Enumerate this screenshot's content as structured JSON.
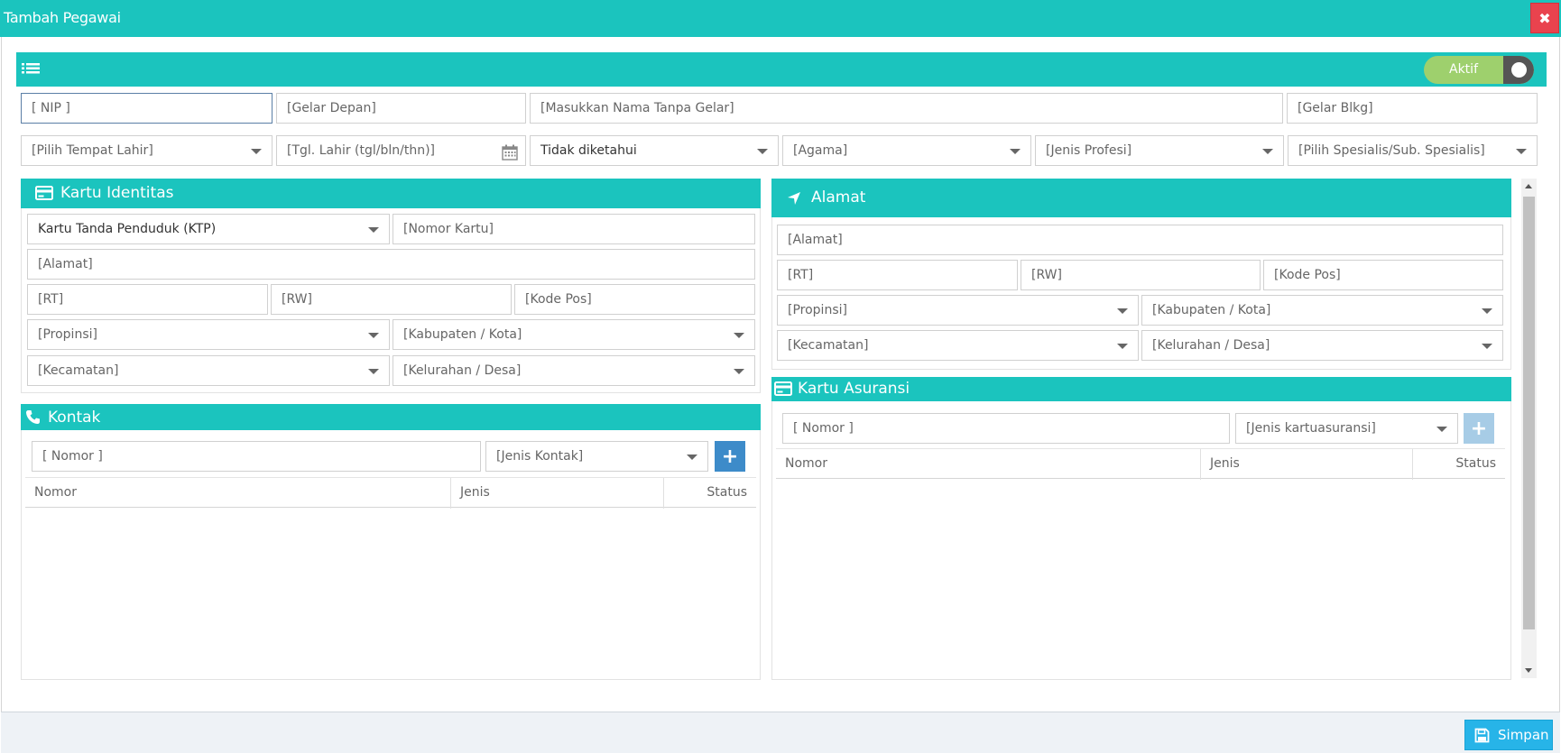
{
  "window": {
    "title": "Tambah Pegawai",
    "close": "✖"
  },
  "status_toggle": {
    "label": "Aktif",
    "on": true
  },
  "row1": {
    "nip": "[ NIP ]",
    "gelar_depan": "[Gelar Depan]",
    "nama": "[Masukkan Nama Tanpa Gelar]",
    "gelar_belakang": "[Gelar Blkg]"
  },
  "row2": {
    "tempat_lahir": "[Pilih Tempat Lahir]",
    "tgl_lahir": "[Tgl. Lahir (tgl/bln/thn)]",
    "jenis_kelamin": "Tidak diketahui",
    "agama": "[Agama]",
    "jenis_profesi": "[Jenis Profesi]",
    "spesialis": "[Pilih Spesialis/Sub. Spesialis]"
  },
  "kartu_identitas": {
    "title": "Kartu Identitas",
    "jenis_kartu": "Kartu Tanda Penduduk (KTP)",
    "nomor_kartu": "[Nomor Kartu]",
    "alamat": "[Alamat]",
    "rt": "[RT]",
    "rw": "[RW]",
    "kode_pos": "[Kode Pos]",
    "propinsi": "[Propinsi]",
    "kabupaten": "[Kabupaten / Kota]",
    "kecamatan": "[Kecamatan]",
    "kelurahan": "[Kelurahan / Desa]"
  },
  "alamat": {
    "title": "Alamat",
    "alamat": "[Alamat]",
    "rt": "[RT]",
    "rw": "[RW]",
    "kode_pos": "[Kode Pos]",
    "propinsi": "[Propinsi]",
    "kabupaten": "[Kabupaten / Kota]",
    "kecamatan": "[Kecamatan]",
    "kelurahan": "[Kelurahan / Desa]"
  },
  "kontak": {
    "title": "Kontak",
    "nomor": "[ Nomor ]",
    "jenis": "[Jenis Kontak]",
    "add": "+",
    "columns": [
      "Nomor",
      "Jenis",
      "Status"
    ]
  },
  "kartu_asuransi": {
    "title": "Kartu Asuransi",
    "nomor": "[ Nomor ]",
    "jenis": "[Jenis kartuasuransi]",
    "add": "+",
    "columns": [
      "Nomor",
      "Jenis",
      "Status"
    ]
  },
  "footer": {
    "save_label": "Simpan"
  },
  "colors": {
    "accent": "#1bc4be",
    "close": "#e9434e",
    "toggle_on": "#9ed06d",
    "add_active": "#3d8bc9",
    "add_disabled": "#a7cce6",
    "save": "#27b4e8"
  }
}
